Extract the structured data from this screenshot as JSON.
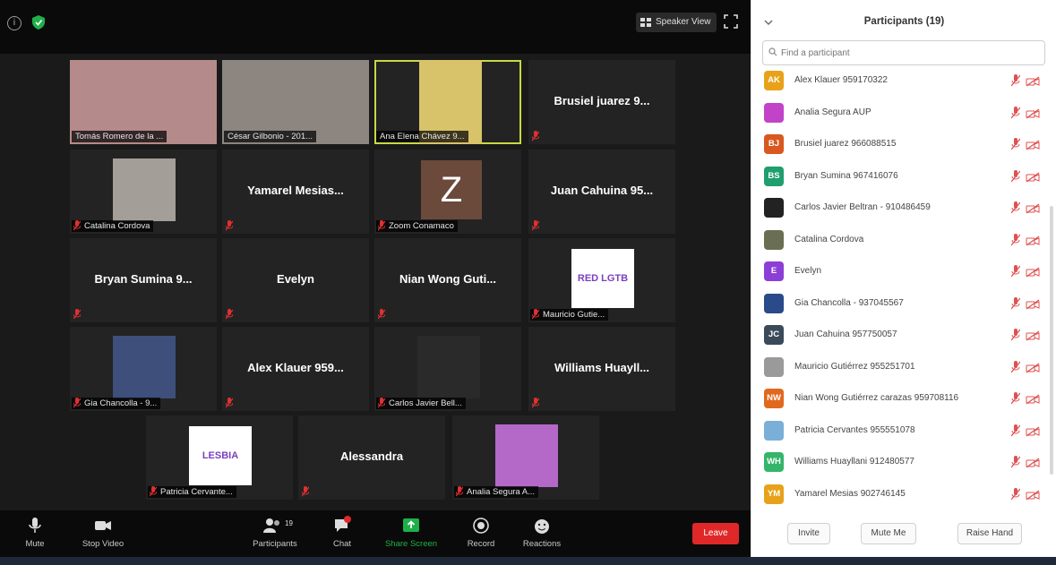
{
  "topbar": {
    "speaker_view_label": "Speaker View"
  },
  "tiles": [
    {
      "label": "Tomás Romero de la ...",
      "kind": "video"
    },
    {
      "label": "César Gilbonio - 201...",
      "kind": "video"
    },
    {
      "label": "Ana Elena Chávez 9...",
      "kind": "video",
      "active": true
    },
    {
      "name": "Brusiel juarez 9...",
      "kind": "name"
    },
    {
      "label": "Catalina Cordova",
      "kind": "video"
    },
    {
      "name": "Yamarel Mesias...",
      "kind": "name"
    },
    {
      "label": "Zoom Conamaco",
      "kind": "letter",
      "letter": "Z"
    },
    {
      "name": "Juan Cahuina 95...",
      "kind": "name"
    },
    {
      "name": "Bryan Sumina 9...",
      "kind": "name"
    },
    {
      "name": "Evelyn",
      "kind": "name"
    },
    {
      "name": "Nian Wong Guti...",
      "kind": "name"
    },
    {
      "label": "Mauricio Gutie...",
      "kind": "logo",
      "logo_text": "RED LGTB"
    },
    {
      "label": "Gia Chancolla - 9...",
      "kind": "video"
    },
    {
      "name": "Alex Klauer 959...",
      "kind": "name"
    },
    {
      "label": "Carlos Javier Bell...",
      "kind": "video"
    },
    {
      "name": "Williams Huayll...",
      "kind": "name"
    },
    {
      "label": "Patricia Cervante...",
      "kind": "logo",
      "logo_text": "LESBIA"
    },
    {
      "name": "Alessandra",
      "kind": "name"
    },
    {
      "label": "Analia Segura A...",
      "kind": "video"
    }
  ],
  "toolbar": {
    "mute": "Mute",
    "stop_video": "Stop Video",
    "participants": "Participants",
    "participants_count": "19",
    "chat": "Chat",
    "share_screen": "Share Screen",
    "record": "Record",
    "reactions": "Reactions",
    "end": "Leave"
  },
  "panel": {
    "title": "Participants (19)",
    "search_placeholder": "Find a participant",
    "participants": [
      {
        "initials": "AK",
        "name": "Alex Klauer 959170322",
        "color": "#e8a21a"
      },
      {
        "initials": "",
        "name": "Analia Segura AUP",
        "color": "#c043c8"
      },
      {
        "initials": "BJ",
        "name": "Brusiel juarez 966088515",
        "color": "#d9581f"
      },
      {
        "initials": "BS",
        "name": "Bryan Sumina 967416076",
        "color": "#1f9e6e"
      },
      {
        "initials": "",
        "name": "Carlos Javier Beltran - 910486459",
        "color": "#222222"
      },
      {
        "initials": "",
        "name": "Catalina Cordova",
        "color": "#6a6f54"
      },
      {
        "initials": "E",
        "name": "Evelyn",
        "color": "#8c3fd6"
      },
      {
        "initials": "",
        "name": "Gia Chancolla - 937045567",
        "color": "#2a4a8a"
      },
      {
        "initials": "JC",
        "name": "Juan Cahuina 957750057",
        "color": "#3a4a5a"
      },
      {
        "initials": "",
        "name": "Mauricio Gutiérrez 955251701",
        "color": "#9a9a9a"
      },
      {
        "initials": "NW",
        "name": "Nian Wong Gutiérrez carazas 959708116",
        "color": "#e0691f"
      },
      {
        "initials": "",
        "name": "Patricia Cervantes 955551078",
        "color": "#7ab0d8"
      },
      {
        "initials": "WH",
        "name": "Williams Huayllani 912480577",
        "color": "#35b56a"
      },
      {
        "initials": "YM",
        "name": "Yamarel Mesias 902746145",
        "color": "#e8a21a"
      }
    ],
    "invite": "Invite",
    "mute_me": "Mute Me",
    "raise_hand": "Raise Hand"
  }
}
